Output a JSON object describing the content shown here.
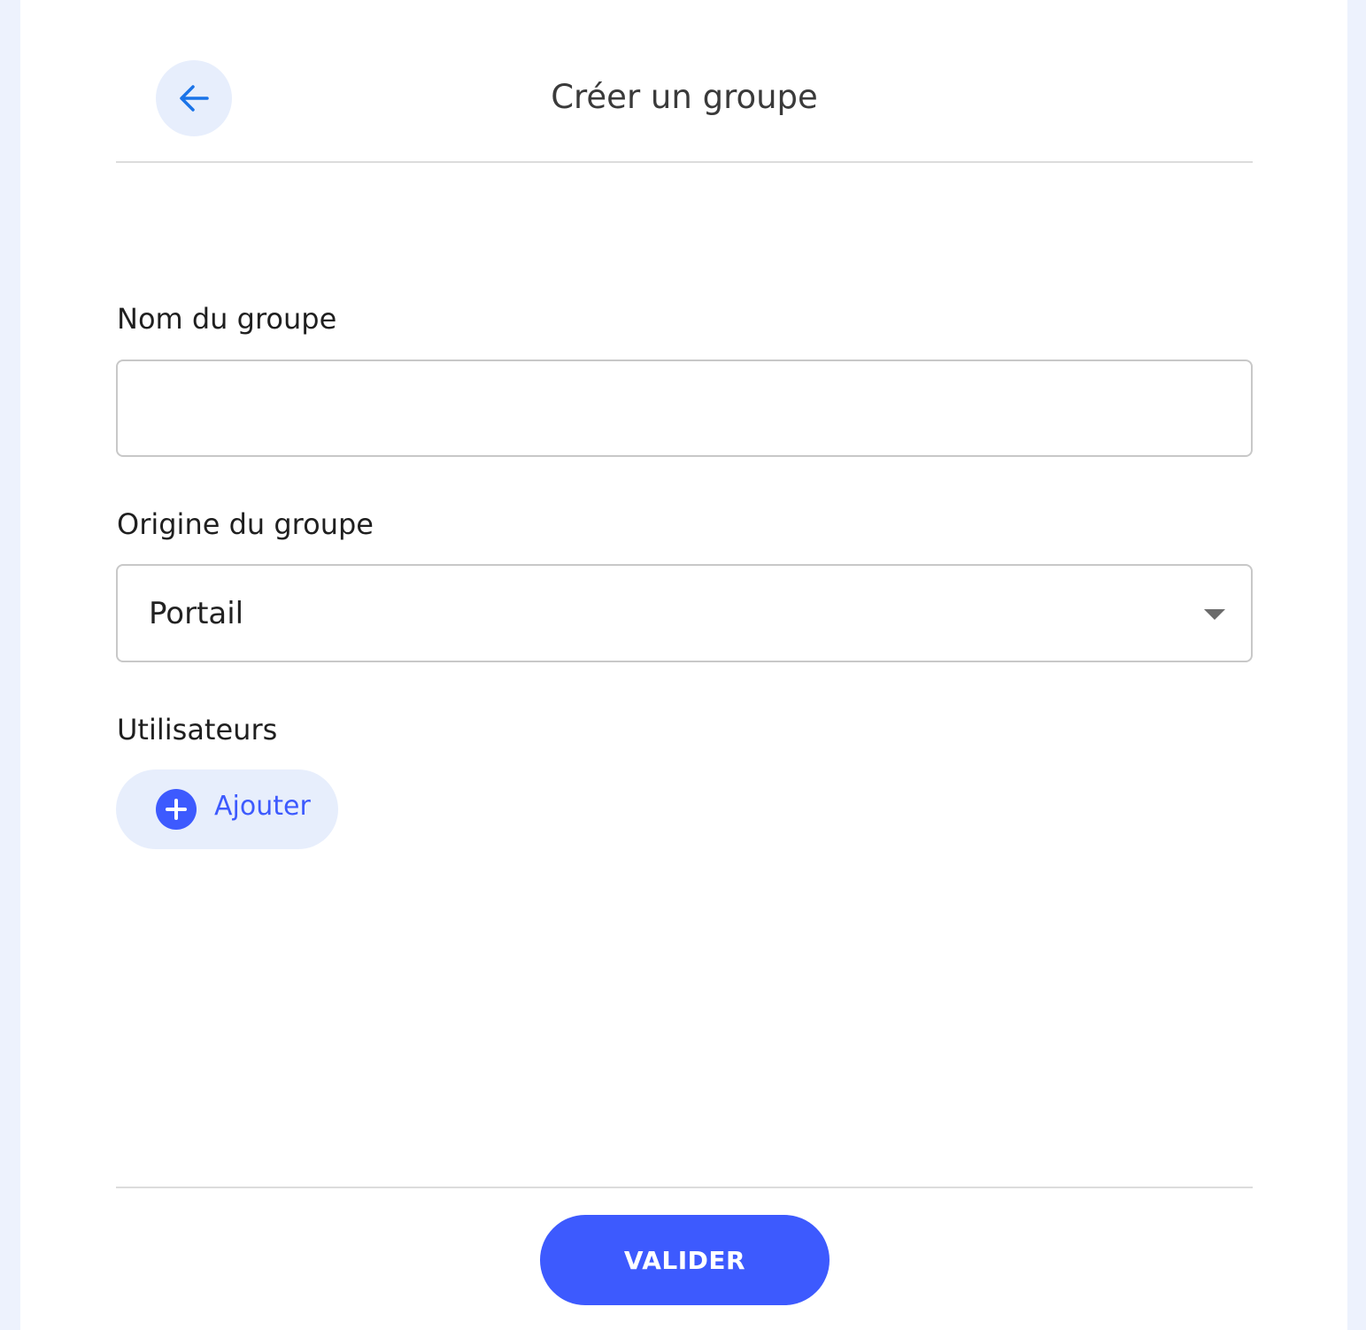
{
  "header": {
    "title": "Créer un groupe",
    "back_icon": "arrow-left-icon"
  },
  "form": {
    "name": {
      "label": "Nom du groupe",
      "value": "",
      "placeholder": ""
    },
    "origin": {
      "label": "Origine du groupe",
      "selected": "Portail",
      "caret_icon": "caret-down-icon"
    },
    "users": {
      "label": "Utilisateurs",
      "add_label": "Ajouter",
      "add_icon": "plus-circle-icon"
    }
  },
  "footer": {
    "submit_label": "VALIDER"
  },
  "colors": {
    "accent": "#3d5afe",
    "accent_soft": "#e7eefc",
    "page_background": "#edf2fd",
    "back_arrow": "#1a73e8"
  }
}
